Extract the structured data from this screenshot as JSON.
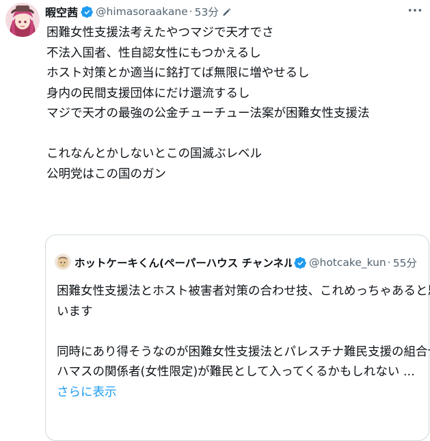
{
  "tweet": {
    "author_name": "暇空茜",
    "author_handle": "@himasoraakane",
    "separator": "·",
    "time": "53分",
    "lines": [
      "困難女性支援法考えたやつマジで天才でさ",
      "不法入国者、性自認女性にもつかえるし",
      "ホスト対策とか適当に銘打てば無限に増やせるし",
      "身内の民間支援団体にだけ還流するし",
      "マジで天才の最強の公金チューチュー法案が困難女性支援法",
      "",
      "これなんとかしないとこの国滅ぶレベル",
      "公明党はこの国のガン"
    ]
  },
  "quote": {
    "author_name": "ホットケーキくん(ペーパーハウス チャンネル",
    "author_handle": "@hotcake_kun",
    "separator": "·",
    "time": "55分",
    "lines": [
      "困難女性支援法とホスト被害者対策の合わせ技、これめっちゃあると思",
      "います",
      "",
      "同時にあり得そうなのが困難女性支援法とパレスチナ難民支援の組合せ",
      "ハマスの関係者(女性限定)が難民として入ってくるかもしれない ..."
    ],
    "show_more": "さらに表示"
  },
  "colors": {
    "verified": "#1d9bf0",
    "link": "#1d9bf0",
    "secondary_text": "#536471",
    "border": "#cfd9de"
  },
  "icons": {
    "verified": "verified-badge-icon",
    "edit": "edited-pencil-icon",
    "more": "more-options-icon"
  }
}
